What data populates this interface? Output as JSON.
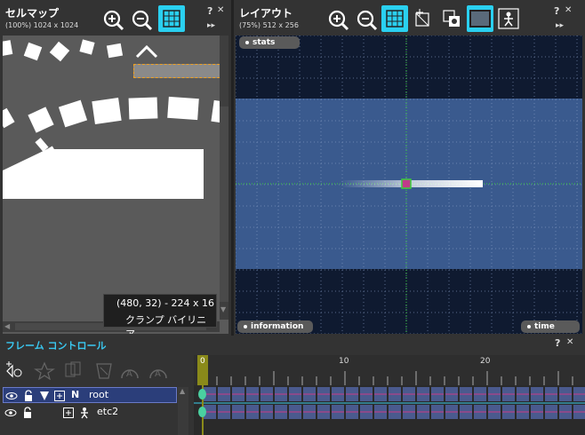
{
  "cellmap": {
    "title": "セルマップ",
    "zoom_info": "(100%) 1024 x 1024",
    "tooltip_coords": "(480, 32) - 224 x 16",
    "tooltip_label": "クランプ バイリニア"
  },
  "layout": {
    "title": "レイアウト",
    "zoom_info": "(75%) 512 x 256",
    "stats_label": "stats",
    "information_label": "information",
    "time_label": "time"
  },
  "frame_control": {
    "title": "フレーム コントロール",
    "ruler_ticks": [
      "0",
      "10",
      "20"
    ],
    "current_frame": "0",
    "layers": [
      {
        "name": "root",
        "prefix": "N"
      },
      {
        "name": "etc2",
        "prefix": ""
      }
    ]
  },
  "common": {
    "help_label": "?",
    "close_label": "✕",
    "expand_label": "▸▸"
  },
  "colors": {
    "accent_active": "#2ad0f0",
    "layout_bg": "#0f1a30",
    "layout_stage": "#3a5a8e",
    "row_selected": "#2b3e7a",
    "timeline_track": "#4a5a8e",
    "frame_marker": "#8a8a1a"
  }
}
